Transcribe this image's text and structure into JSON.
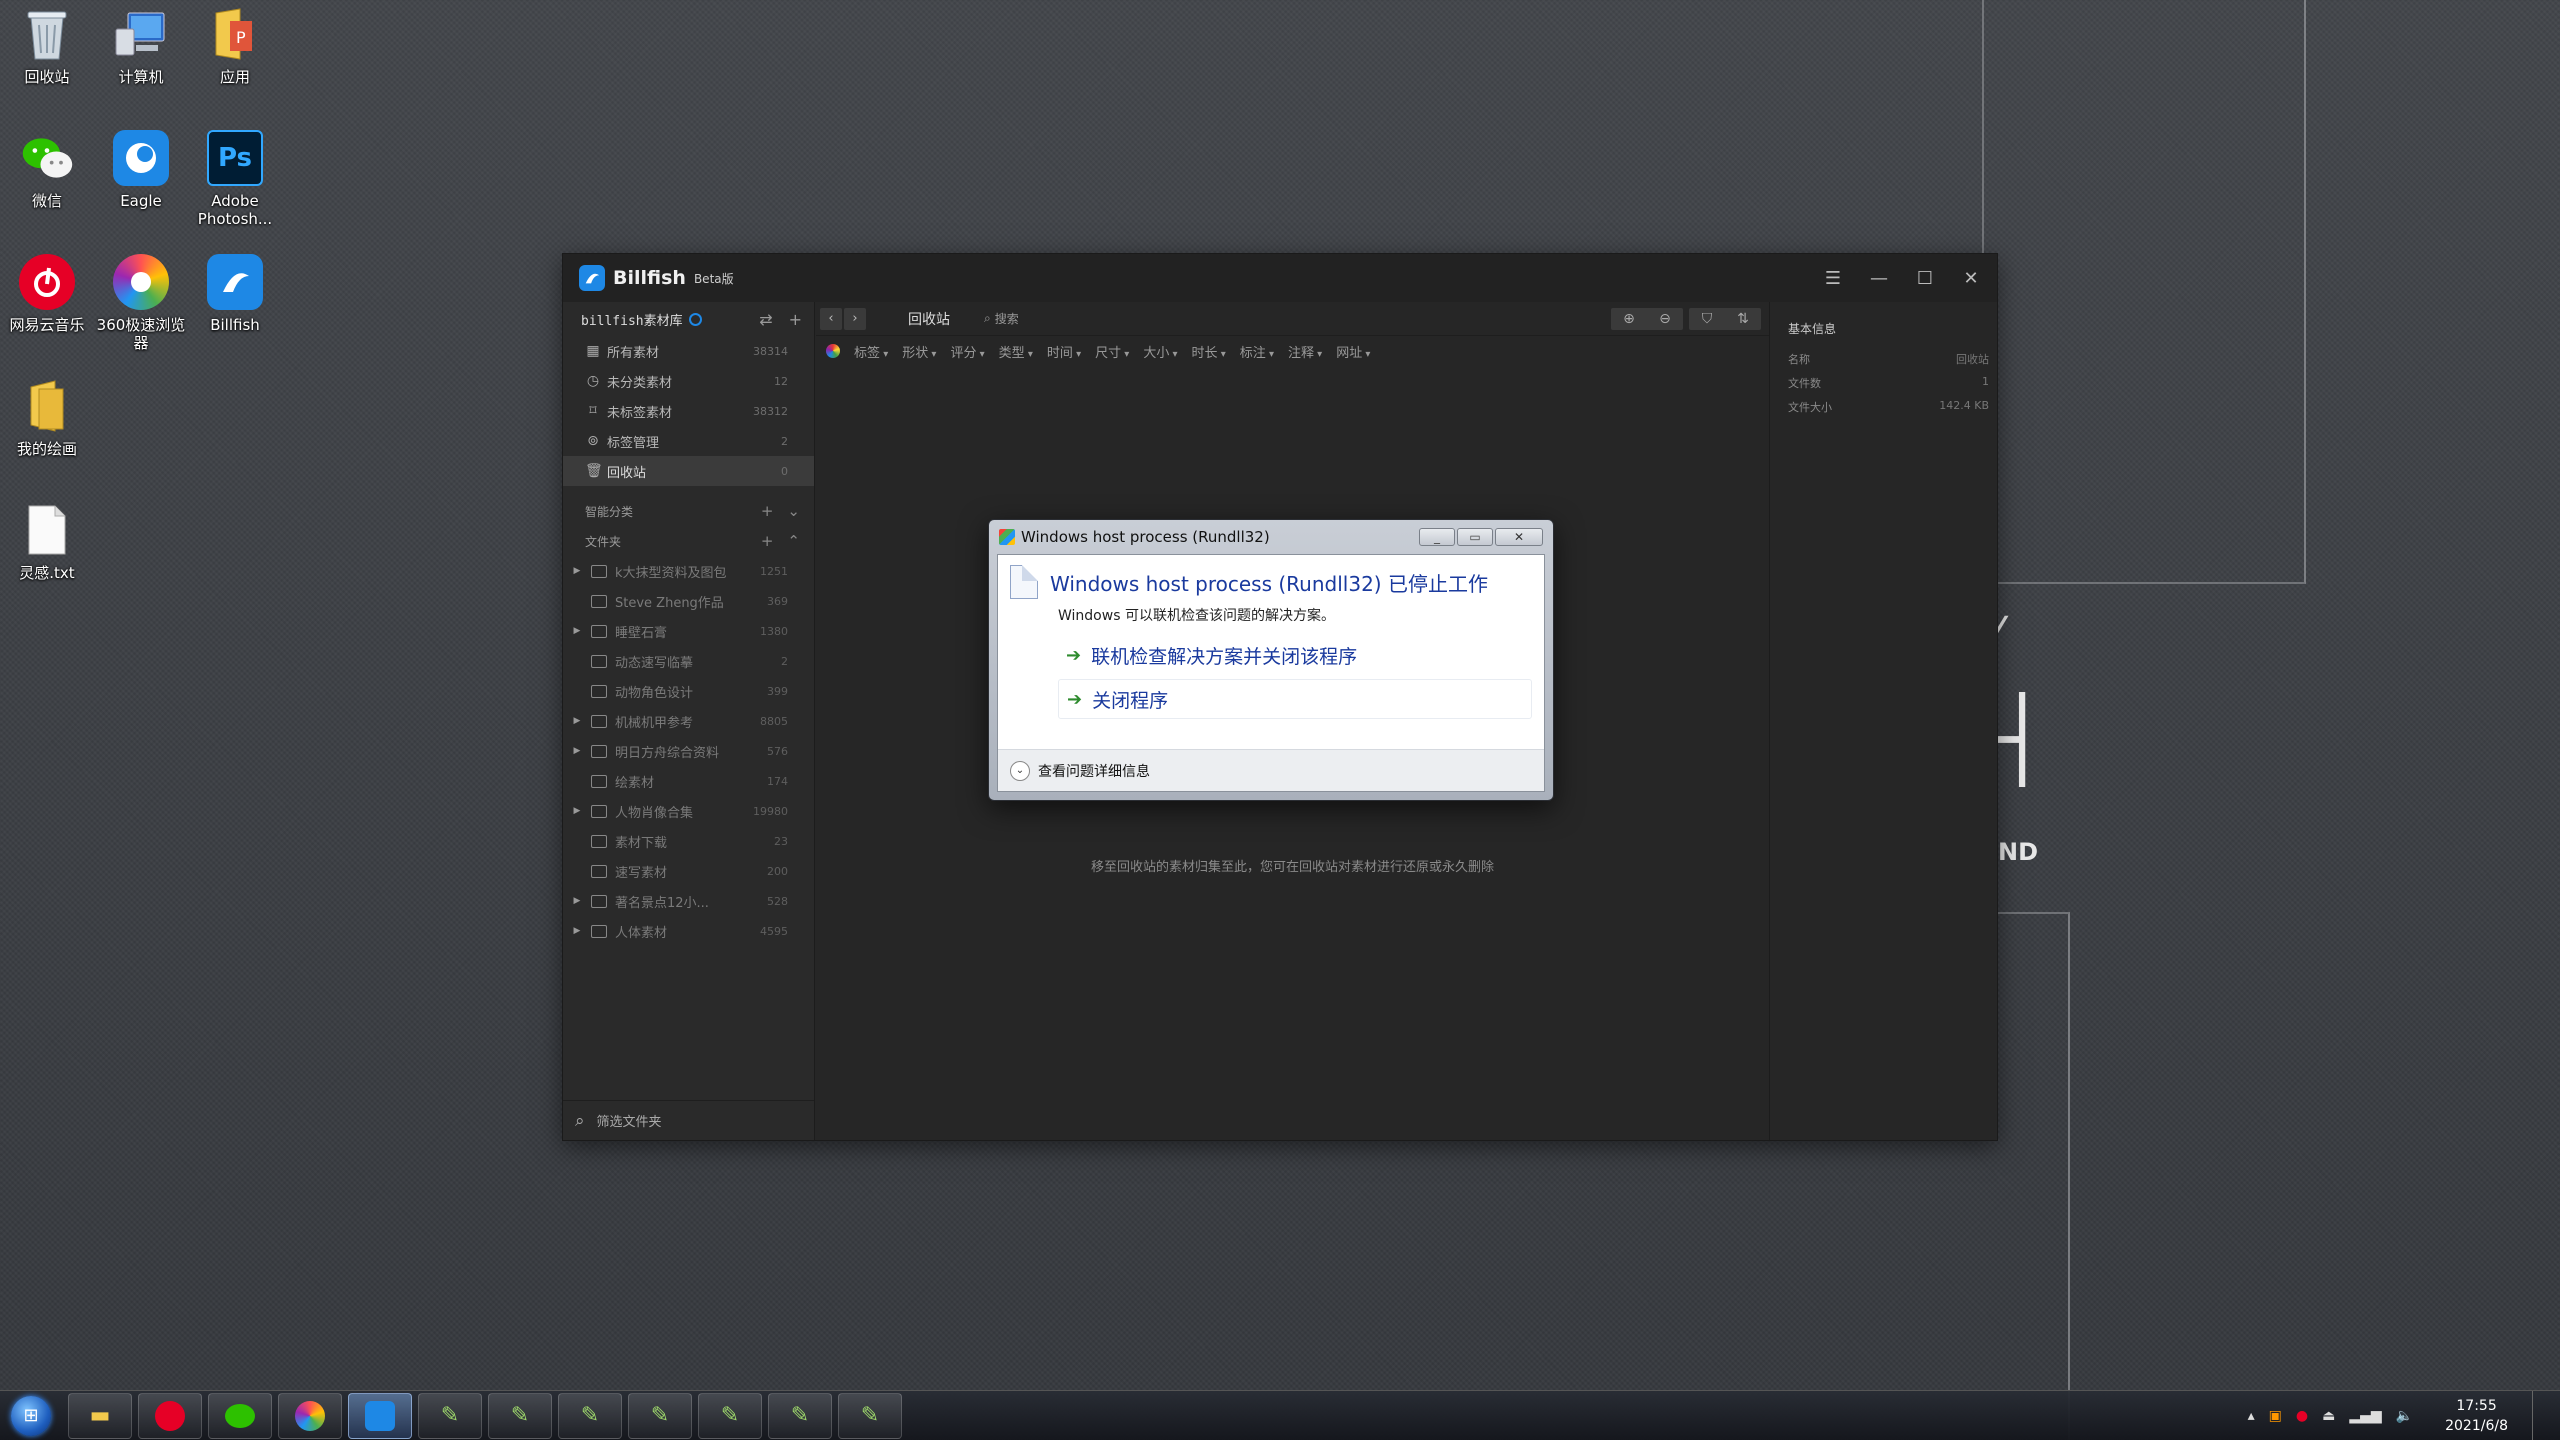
{
  "desktop": {
    "icons": [
      {
        "label": "回收站",
        "icon": "recycle-bin-icon"
      },
      {
        "label": "计算机",
        "icon": "computer-icon"
      },
      {
        "label": "应用",
        "icon": "folder-icon"
      },
      {
        "label": "微信",
        "icon": "wechat-icon"
      },
      {
        "label": "Eagle",
        "icon": "eagle-icon"
      },
      {
        "label": "Adobe\nPhotosh...",
        "icon": "photoshop-icon"
      },
      {
        "label": "网易云音乐",
        "icon": "netease-music-icon"
      },
      {
        "label": "360极速浏览器",
        "icon": "360-browser-icon"
      },
      {
        "label": "Billfish",
        "icon": "billfish-icon"
      },
      {
        "label": "我的绘画",
        "icon": "folder-icon"
      },
      {
        "label": "灵感.txt",
        "icon": "text-file-icon"
      }
    ],
    "bg_text": {
      "letter": "ND"
    }
  },
  "app": {
    "name": "Billfish",
    "beta": "Beta版",
    "library": "billfish素材库",
    "nav": [
      {
        "label": "所有素材",
        "count": "38314",
        "icon": "grid-icon"
      },
      {
        "label": "未分类素材",
        "count": "12",
        "icon": "clock-icon"
      },
      {
        "label": "未标签素材",
        "count": "38312",
        "icon": "tag-off-icon"
      },
      {
        "label": "标签管理",
        "count": "2",
        "icon": "tag-icon"
      },
      {
        "label": "回收站",
        "count": "0",
        "icon": "trash-icon"
      }
    ],
    "smart_section": "智能分类",
    "folder_section": "文件夹",
    "folders": [
      {
        "label": "k大抹型资料及图包",
        "count": "1251",
        "expandable": true
      },
      {
        "label": "Steve Zheng作品",
        "count": "369",
        "expandable": false
      },
      {
        "label": "睡壁石膏",
        "count": "1380",
        "expandable": true
      },
      {
        "label": "动态速写临摹",
        "count": "2",
        "expandable": false
      },
      {
        "label": "动物角色设计",
        "count": "399",
        "expandable": false
      },
      {
        "label": "机械机甲参考",
        "count": "8805",
        "expandable": true
      },
      {
        "label": "明日方舟综合资料",
        "count": "576",
        "expandable": true
      },
      {
        "label": "绘素材",
        "count": "174",
        "expandable": false
      },
      {
        "label": "人物肖像合集",
        "count": "19980",
        "expandable": true
      },
      {
        "label": "素材下载",
        "count": "23",
        "expandable": false
      },
      {
        "label": "速写素材",
        "count": "200",
        "expandable": false
      },
      {
        "label": "著名景点12小...",
        "count": "528",
        "expandable": true
      },
      {
        "label": "人体素材",
        "count": "4595",
        "expandable": true
      }
    ],
    "folder_search_placeholder": "筛选文件夹",
    "breadcrumb": "回收站",
    "search_placeholder": "搜索",
    "filters": [
      "标签",
      "形状",
      "评分",
      "类型",
      "时间",
      "尺寸",
      "大小",
      "时长",
      "标注",
      "注释",
      "网址"
    ],
    "empty_hint": "移至回收站的素材归集至此，您可在回收站对素材进行还原或永久删除",
    "info": {
      "heading": "基本信息",
      "rows": [
        {
          "k": "名称",
          "v": "回收站"
        },
        {
          "k": "文件数",
          "v": "1"
        },
        {
          "k": "文件大小",
          "v": "142.4 KB"
        }
      ]
    }
  },
  "dialog": {
    "title": "Windows host process (Rundll32)",
    "heading": "Windows host process (Rundll32) 已停止工作",
    "sub": "Windows 可以联机检查该问题的解决方案。",
    "option1": "联机检查解决方案并关闭该程序",
    "option2": "关闭程序",
    "details": "查看问题详细信息"
  },
  "taskbar": {
    "time": "17:55",
    "date": "2021/6/8"
  }
}
